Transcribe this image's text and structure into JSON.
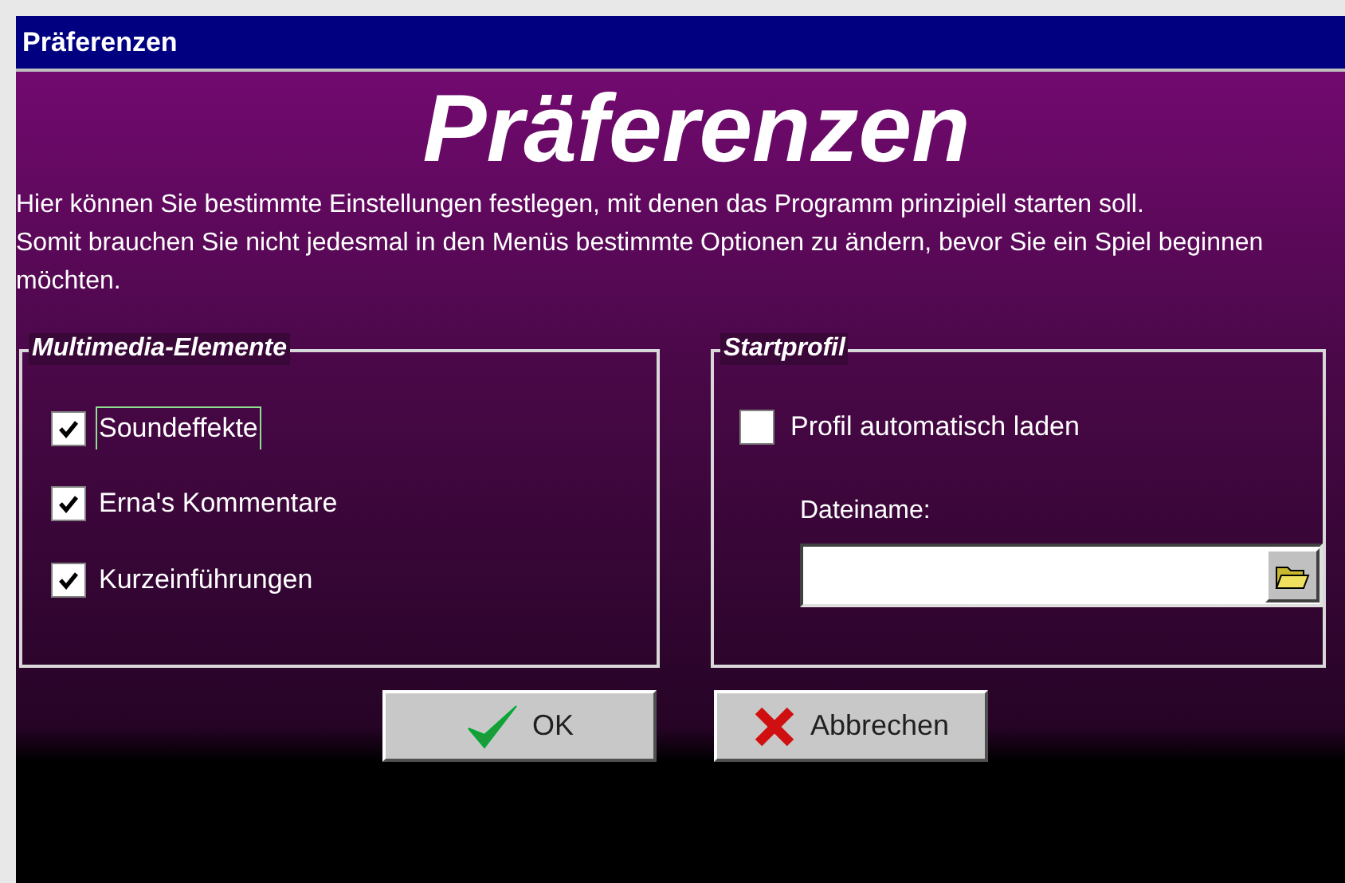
{
  "window": {
    "title": "Präferenzen"
  },
  "heading": "Präferenzen",
  "intro": [
    "Hier können Sie bestimmte Einstellungen festlegen, mit denen das Programm prinzipiell starten soll.",
    "Somit brauchen Sie nicht jedesmal in den Menüs bestimmte Optionen zu ändern, bevor Sie ein Spiel beginnen möchten."
  ],
  "multimedia": {
    "title": "Multimedia-Elemente",
    "options": [
      {
        "label": "Soundeffekte",
        "checked": true,
        "focused": true
      },
      {
        "label": "Erna's Kommentare",
        "checked": true,
        "focused": false
      },
      {
        "label": "Kurzeinführungen",
        "checked": true,
        "focused": false
      }
    ]
  },
  "startprofil": {
    "title": "Startprofil",
    "option": {
      "label": "Profil automatisch laden",
      "checked": false
    },
    "file_label": "Dateiname:"
  },
  "buttons": [
    {
      "label": "OK",
      "kind": "ok"
    },
    {
      "label": "Abbrechen",
      "kind": "cancel"
    }
  ]
}
